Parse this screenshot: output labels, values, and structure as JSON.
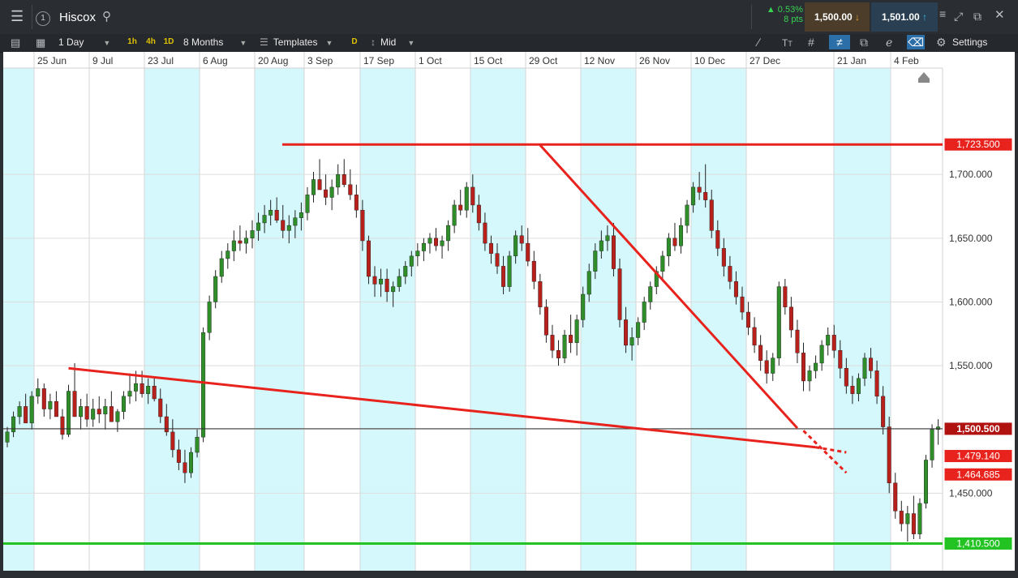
{
  "header": {
    "symbol": "Hiscox",
    "change_pct": "0.53%",
    "change_pts": "8 pts",
    "sell_price": "1,500.00",
    "buy_price": "1,501.00"
  },
  "toolbar": {
    "interval": "1 Day",
    "quick_1h": "1h",
    "quick_4h": "4h",
    "quick_1d": "1D",
    "range": "8 Months",
    "templates": "Templates",
    "d_badge": "D",
    "price_mode": "Mid",
    "settings": "Settings"
  },
  "chart_data": {
    "type": "candlestick",
    "x_ticks": [
      "25 Jun",
      "9 Jul",
      "23 Jul",
      "6 Aug",
      "20 Aug",
      "3 Sep",
      "17 Sep",
      "1 Oct",
      "15 Oct",
      "29 Oct",
      "12 Nov",
      "26 Nov",
      "10 Dec",
      "27 Dec",
      "21 Jan",
      "4 Feb"
    ],
    "y_ticks": [
      "1,700.000",
      "1,650.000",
      "1,600.000",
      "1,550.000",
      "1,500.000",
      "1,450.000"
    ],
    "y_tick_values": [
      1700,
      1650,
      1600,
      1550,
      1500,
      1450
    ],
    "ylim": [
      1393,
      1730
    ],
    "current_price": 1500.5,
    "current_label": "1,500.500",
    "levels": [
      {
        "value": 1723.5,
        "label": "1,723.500",
        "color": "#e8221c"
      },
      {
        "value": 1479.14,
        "label": "1.479.140",
        "color": "#e8221c"
      },
      {
        "value": 1464.685,
        "label": "1.464.685",
        "color": "#e8221c"
      },
      {
        "value": 1410.5,
        "label": "1,410.500",
        "color": "#22c322"
      }
    ],
    "trendlines": [
      {
        "from": [
          10,
          1548
        ],
        "to": [
          132,
          1486
        ],
        "style": "solid",
        "color": "#e8221c"
      },
      {
        "from": [
          132,
          1486
        ],
        "to": [
          137,
          1482
        ],
        "style": "dashed",
        "color": "#e8221c"
      },
      {
        "from": [
          87,
          1723
        ],
        "to": [
          129,
          1501
        ],
        "style": "solid",
        "color": "#e8221c"
      },
      {
        "from": [
          130,
          1499
        ],
        "to": [
          137,
          1466
        ],
        "style": "dashed",
        "color": "#e8221c"
      }
    ],
    "ohlc": [
      [
        1490,
        1502,
        1486,
        1498
      ],
      [
        1498,
        1514,
        1494,
        1510
      ],
      [
        1510,
        1522,
        1504,
        1518
      ],
      [
        1518,
        1528,
        1512,
        1505
      ],
      [
        1505,
        1530,
        1500,
        1526
      ],
      [
        1526,
        1540,
        1520,
        1532
      ],
      [
        1532,
        1536,
        1510,
        1516
      ],
      [
        1516,
        1528,
        1508,
        1522
      ],
      [
        1522,
        1530,
        1515,
        1510
      ],
      [
        1510,
        1516,
        1492,
        1496
      ],
      [
        1496,
        1535,
        1494,
        1530
      ],
      [
        1530,
        1552,
        1518,
        1510
      ],
      [
        1510,
        1524,
        1500,
        1518
      ],
      [
        1518,
        1528,
        1502,
        1508
      ],
      [
        1508,
        1524,
        1502,
        1516
      ],
      [
        1516,
        1526,
        1505,
        1512
      ],
      [
        1512,
        1524,
        1500,
        1518
      ],
      [
        1518,
        1530,
        1510,
        1506
      ],
      [
        1506,
        1516,
        1498,
        1514
      ],
      [
        1514,
        1530,
        1508,
        1526
      ],
      [
        1526,
        1544,
        1520,
        1530
      ],
      [
        1530,
        1546,
        1522,
        1536
      ],
      [
        1536,
        1546,
        1525,
        1528
      ],
      [
        1528,
        1540,
        1520,
        1534
      ],
      [
        1534,
        1540,
        1522,
        1524
      ],
      [
        1524,
        1532,
        1505,
        1510
      ],
      [
        1510,
        1520,
        1495,
        1498
      ],
      [
        1498,
        1508,
        1478,
        1484
      ],
      [
        1484,
        1492,
        1468,
        1474
      ],
      [
        1474,
        1484,
        1458,
        1466
      ],
      [
        1466,
        1486,
        1462,
        1482
      ],
      [
        1482,
        1500,
        1478,
        1494
      ],
      [
        1494,
        1580,
        1490,
        1576
      ],
      [
        1576,
        1605,
        1570,
        1600
      ],
      [
        1600,
        1625,
        1595,
        1620
      ],
      [
        1620,
        1640,
        1615,
        1634
      ],
      [
        1634,
        1646,
        1626,
        1640
      ],
      [
        1640,
        1656,
        1632,
        1648
      ],
      [
        1648,
        1660,
        1640,
        1646
      ],
      [
        1646,
        1656,
        1638,
        1650
      ],
      [
        1650,
        1664,
        1642,
        1656
      ],
      [
        1656,
        1670,
        1648,
        1662
      ],
      [
        1662,
        1676,
        1654,
        1668
      ],
      [
        1668,
        1680,
        1660,
        1672
      ],
      [
        1672,
        1682,
        1662,
        1664
      ],
      [
        1664,
        1676,
        1650,
        1656
      ],
      [
        1656,
        1668,
        1646,
        1660
      ],
      [
        1660,
        1672,
        1650,
        1666
      ],
      [
        1666,
        1678,
        1656,
        1670
      ],
      [
        1670,
        1690,
        1664,
        1684
      ],
      [
        1684,
        1702,
        1678,
        1696
      ],
      [
        1696,
        1712,
        1690,
        1688
      ],
      [
        1688,
        1700,
        1676,
        1682
      ],
      [
        1682,
        1696,
        1672,
        1690
      ],
      [
        1690,
        1708,
        1684,
        1700
      ],
      [
        1700,
        1712,
        1690,
        1692
      ],
      [
        1692,
        1704,
        1680,
        1684
      ],
      [
        1684,
        1692,
        1666,
        1672
      ],
      [
        1672,
        1680,
        1640,
        1648
      ],
      [
        1648,
        1652,
        1614,
        1620
      ],
      [
        1620,
        1628,
        1604,
        1614
      ],
      [
        1614,
        1626,
        1604,
        1618
      ],
      [
        1618,
        1626,
        1600,
        1608
      ],
      [
        1608,
        1616,
        1596,
        1612
      ],
      [
        1612,
        1626,
        1608,
        1620
      ],
      [
        1620,
        1632,
        1614,
        1628
      ],
      [
        1628,
        1640,
        1620,
        1636
      ],
      [
        1636,
        1646,
        1628,
        1640
      ],
      [
        1640,
        1650,
        1632,
        1646
      ],
      [
        1646,
        1654,
        1638,
        1650
      ],
      [
        1650,
        1658,
        1640,
        1644
      ],
      [
        1644,
        1652,
        1634,
        1648
      ],
      [
        1648,
        1664,
        1640,
        1660
      ],
      [
        1660,
        1680,
        1654,
        1676
      ],
      [
        1676,
        1688,
        1668,
        1672
      ],
      [
        1672,
        1694,
        1666,
        1690
      ],
      [
        1690,
        1700,
        1670,
        1676
      ],
      [
        1676,
        1684,
        1656,
        1662
      ],
      [
        1662,
        1670,
        1640,
        1646
      ],
      [
        1646,
        1652,
        1630,
        1638
      ],
      [
        1638,
        1646,
        1622,
        1628
      ],
      [
        1628,
        1636,
        1606,
        1612
      ],
      [
        1612,
        1640,
        1608,
        1636
      ],
      [
        1636,
        1656,
        1630,
        1652
      ],
      [
        1652,
        1660,
        1640,
        1646
      ],
      [
        1646,
        1658,
        1628,
        1632
      ],
      [
        1632,
        1640,
        1610,
        1616
      ],
      [
        1616,
        1622,
        1590,
        1596
      ],
      [
        1596,
        1602,
        1568,
        1574
      ],
      [
        1574,
        1582,
        1556,
        1562
      ],
      [
        1562,
        1570,
        1550,
        1556
      ],
      [
        1556,
        1578,
        1552,
        1574
      ],
      [
        1574,
        1590,
        1560,
        1568
      ],
      [
        1568,
        1590,
        1558,
        1586
      ],
      [
        1586,
        1612,
        1580,
        1606
      ],
      [
        1606,
        1630,
        1600,
        1624
      ],
      [
        1624,
        1646,
        1618,
        1640
      ],
      [
        1640,
        1656,
        1634,
        1648
      ],
      [
        1648,
        1660,
        1640,
        1652
      ],
      [
        1652,
        1662,
        1620,
        1626
      ],
      [
        1626,
        1634,
        1580,
        1586
      ],
      [
        1586,
        1596,
        1560,
        1566
      ],
      [
        1566,
        1580,
        1554,
        1572
      ],
      [
        1572,
        1588,
        1566,
        1584
      ],
      [
        1584,
        1604,
        1578,
        1600
      ],
      [
        1600,
        1616,
        1594,
        1612
      ],
      [
        1612,
        1628,
        1606,
        1624
      ],
      [
        1624,
        1640,
        1616,
        1636
      ],
      [
        1636,
        1654,
        1628,
        1650
      ],
      [
        1650,
        1662,
        1640,
        1644
      ],
      [
        1644,
        1666,
        1638,
        1660
      ],
      [
        1660,
        1680,
        1654,
        1676
      ],
      [
        1676,
        1694,
        1670,
        1690
      ],
      [
        1690,
        1702,
        1680,
        1686
      ],
      [
        1686,
        1708,
        1674,
        1680
      ],
      [
        1680,
        1688,
        1650,
        1656
      ],
      [
        1656,
        1664,
        1636,
        1642
      ],
      [
        1642,
        1650,
        1620,
        1628
      ],
      [
        1628,
        1636,
        1610,
        1616
      ],
      [
        1616,
        1624,
        1598,
        1604
      ],
      [
        1604,
        1612,
        1586,
        1592
      ],
      [
        1592,
        1600,
        1574,
        1580
      ],
      [
        1580,
        1588,
        1560,
        1566
      ],
      [
        1566,
        1574,
        1546,
        1554
      ],
      [
        1554,
        1562,
        1536,
        1544
      ],
      [
        1544,
        1560,
        1538,
        1556
      ],
      [
        1556,
        1616,
        1550,
        1612
      ],
      [
        1612,
        1618,
        1590,
        1596
      ],
      [
        1596,
        1604,
        1572,
        1578
      ],
      [
        1578,
        1586,
        1552,
        1560
      ],
      [
        1560,
        1568,
        1530,
        1538
      ],
      [
        1538,
        1550,
        1530,
        1546
      ],
      [
        1546,
        1558,
        1540,
        1552
      ],
      [
        1552,
        1570,
        1546,
        1566
      ],
      [
        1566,
        1580,
        1558,
        1574
      ],
      [
        1574,
        1582,
        1556,
        1562
      ],
      [
        1562,
        1570,
        1540,
        1548
      ],
      [
        1548,
        1556,
        1528,
        1534
      ],
      [
        1534,
        1542,
        1520,
        1528
      ],
      [
        1528,
        1544,
        1522,
        1540
      ],
      [
        1540,
        1560,
        1534,
        1556
      ],
      [
        1556,
        1564,
        1540,
        1546
      ],
      [
        1546,
        1554,
        1520,
        1526
      ],
      [
        1526,
        1534,
        1496,
        1502
      ],
      [
        1502,
        1510,
        1450,
        1458
      ],
      [
        1458,
        1466,
        1430,
        1436
      ],
      [
        1436,
        1444,
        1420,
        1426
      ],
      [
        1426,
        1440,
        1412,
        1434
      ],
      [
        1434,
        1448,
        1414,
        1418
      ],
      [
        1418,
        1446,
        1414,
        1442
      ],
      [
        1442,
        1480,
        1438,
        1476
      ],
      [
        1476,
        1504,
        1470,
        1500
      ],
      [
        1500,
        1508,
        1488,
        1502
      ]
    ]
  }
}
